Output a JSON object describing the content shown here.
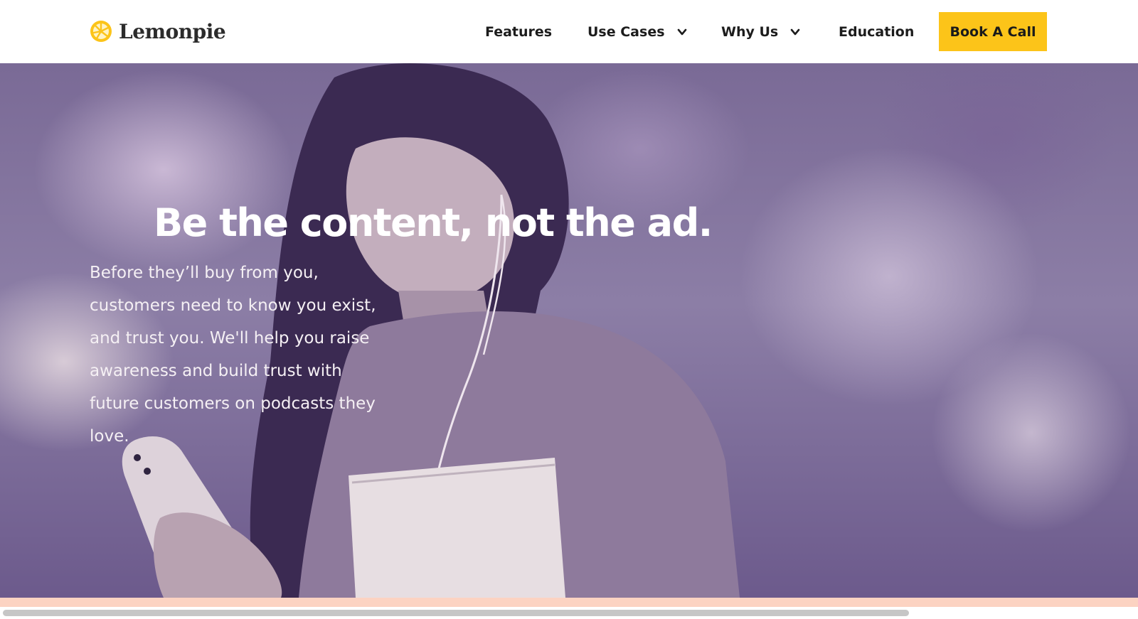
{
  "brand": {
    "name": "Lemonpie",
    "logo_icon": "lemon-slice-icon",
    "accent_color": "#fcc419"
  },
  "nav": {
    "features": "Features",
    "use_cases": "Use Cases",
    "why_us": "Why Us",
    "education": "Education",
    "dropdown_icon": "chevron-down-icon",
    "cta": "Book A Call"
  },
  "hero": {
    "title": "Be the content, not the ad.",
    "body": "Before they’ll buy from you, customers need to know you exist, and trust you. We'll help you raise awareness and build trust with future customers on podcasts they love.",
    "image_tint": "#6f5c91"
  },
  "footer_strip_color": "#fcd3c2"
}
